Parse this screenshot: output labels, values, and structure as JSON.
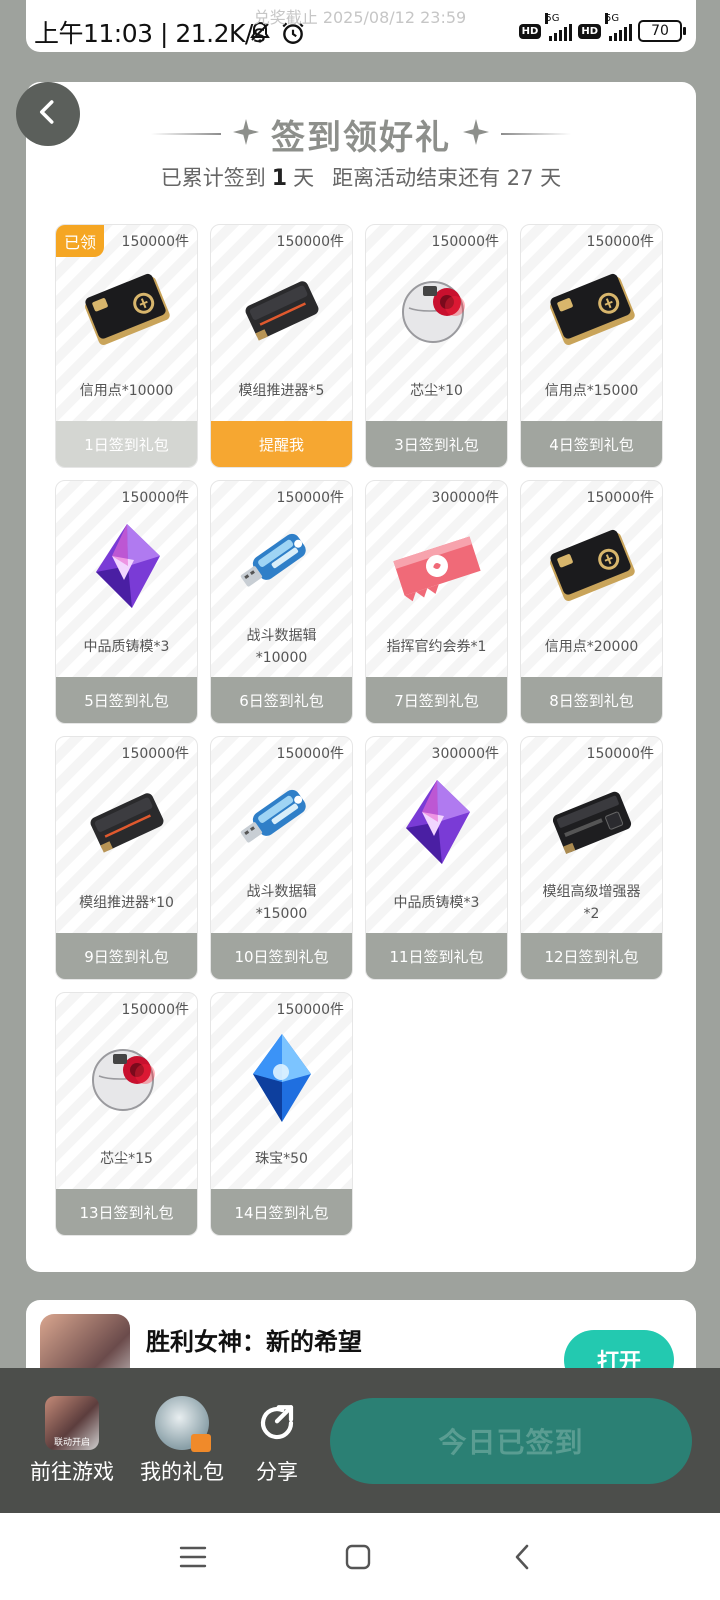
{
  "status_bar": {
    "time": "上午11:03 | 21.2K/s",
    "network_1": "5G",
    "network_2": "5G",
    "hd": "HD",
    "battery": "70"
  },
  "deadline_overlay": "兑奖截止 2025/08/12 23:59",
  "header": {
    "title": "签到领好礼",
    "subtitle_prefix": "已累计签到",
    "signed_days": "1",
    "subtitle_mid": "天",
    "subtitle_end": "距离活动结束还有 27 天"
  },
  "rewards": [
    {
      "stock": "150000件",
      "name": "信用点*10000",
      "button": "1日签到礼包",
      "status": "claimed",
      "badge": "已领",
      "icon": "credit-card-icon"
    },
    {
      "stock": "150000件",
      "name": "模组推进器*5",
      "button": "提醒我",
      "status": "remind",
      "icon": "module-thruster-icon"
    },
    {
      "stock": "150000件",
      "name": "芯尘*10",
      "button": "3日签到礼包",
      "status": "locked",
      "icon": "core-dust-icon"
    },
    {
      "stock": "150000件",
      "name": "信用点*15000",
      "button": "4日签到礼包",
      "status": "locked",
      "icon": "credit-card-icon"
    },
    {
      "stock": "150000件",
      "name": "中品质铸模*3",
      "button": "5日签到礼包",
      "status": "locked",
      "icon": "crystal-mold-icon"
    },
    {
      "stock": "150000件",
      "name": "战斗数据辑\n*10000",
      "button": "6日签到礼包",
      "status": "locked",
      "icon": "battle-data-usb-icon"
    },
    {
      "stock": "300000件",
      "name": "指挥官约会券*1",
      "button": "7日签到礼包",
      "status": "locked",
      "icon": "date-ticket-icon"
    },
    {
      "stock": "150000件",
      "name": "信用点*20000",
      "button": "8日签到礼包",
      "status": "locked",
      "icon": "credit-card-icon"
    },
    {
      "stock": "150000件",
      "name": "模组推进器*10",
      "button": "9日签到礼包",
      "status": "locked",
      "icon": "module-thruster-icon"
    },
    {
      "stock": "150000件",
      "name": "战斗数据辑\n*15000",
      "button": "10日签到礼包",
      "status": "locked",
      "icon": "battle-data-usb-icon"
    },
    {
      "stock": "300000件",
      "name": "中品质铸模*3",
      "button": "11日签到礼包",
      "status": "locked",
      "icon": "crystal-mold-icon"
    },
    {
      "stock": "150000件",
      "name": "模组高级增强器\n*2",
      "button": "12日签到礼包",
      "status": "locked",
      "icon": "module-enhancer-icon"
    },
    {
      "stock": "150000件",
      "name": "芯尘*15",
      "button": "13日签到礼包",
      "status": "locked",
      "icon": "core-dust-icon"
    },
    {
      "stock": "150000件",
      "name": "珠宝*50",
      "button": "14日签到礼包",
      "status": "locked",
      "icon": "jewel-icon"
    }
  ],
  "game": {
    "name": "胜利女神：新的希望",
    "open_label": "打开"
  },
  "bottom_bar": {
    "go_game": "前往游戏",
    "go_game_icon_text": "联动开启",
    "my_gifts": "我的礼包",
    "share": "分享",
    "signed_today": "今日已签到"
  },
  "colors": {
    "background": "#9ea29d",
    "remind": "#f6a731",
    "claimed_badge": "#f5a623",
    "locked_button": "#a1a59f",
    "primary_button": "#2b8074",
    "open_button": "#23c9b0"
  }
}
